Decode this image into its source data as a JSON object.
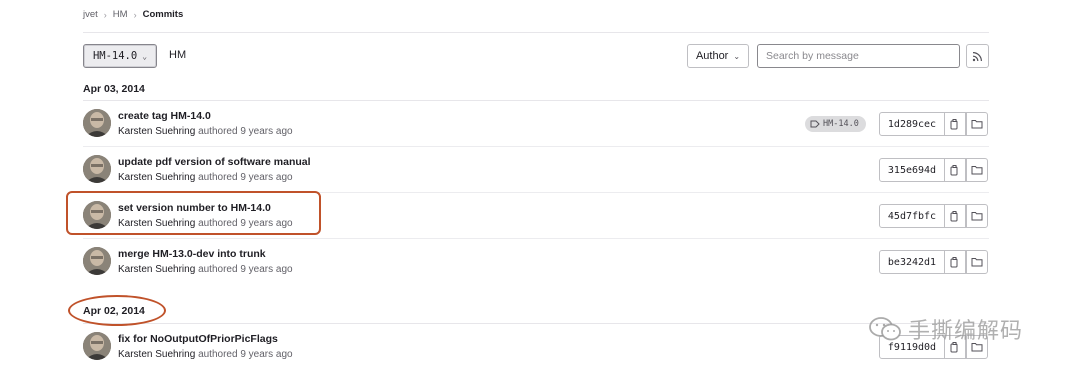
{
  "breadcrumb": [
    "jvet",
    "HM",
    "Commits"
  ],
  "toolbar": {
    "ref_selector": "HM-14.0",
    "ref_name": "HM",
    "author_label": "Author",
    "search_placeholder": "Search by message"
  },
  "days": [
    {
      "date": "Apr 03, 2014",
      "commits": [
        {
          "title": "create tag HM-14.0",
          "author": "Karsten Suehring",
          "authored": "authored",
          "age": "9 years ago",
          "sha": "1d289cec",
          "tag": "HM-14.0"
        },
        {
          "title": "update pdf version of software manual",
          "author": "Karsten Suehring",
          "authored": "authored",
          "age": "9 years ago",
          "sha": "315e694d"
        },
        {
          "title": "set version number to HM-14.0",
          "author": "Karsten Suehring",
          "authored": "authored",
          "age": "9 years ago",
          "sha": "45d7fbfc"
        },
        {
          "title": "merge HM-13.0-dev into trunk",
          "author": "Karsten Suehring",
          "authored": "authored",
          "age": "9 years ago",
          "sha": "be3242d1"
        }
      ]
    },
    {
      "date": "Apr 02, 2014",
      "commits": [
        {
          "title": "fix for NoOutputOfPriorPicFlags",
          "author": "Karsten Suehring",
          "authored": "authored",
          "age": "9 years ago",
          "sha": "f9119d0d"
        }
      ]
    }
  ],
  "watermark_text": "手撕编解码",
  "colors": {
    "annotation": "#c0522a",
    "border": "#bfbfc3",
    "text": "#1f1e24",
    "muted": "#626168"
  },
  "icons": [
    "chevron-down-icon",
    "rss-icon",
    "tag-icon",
    "copy-icon",
    "folder-icon",
    "wechat-icon"
  ]
}
